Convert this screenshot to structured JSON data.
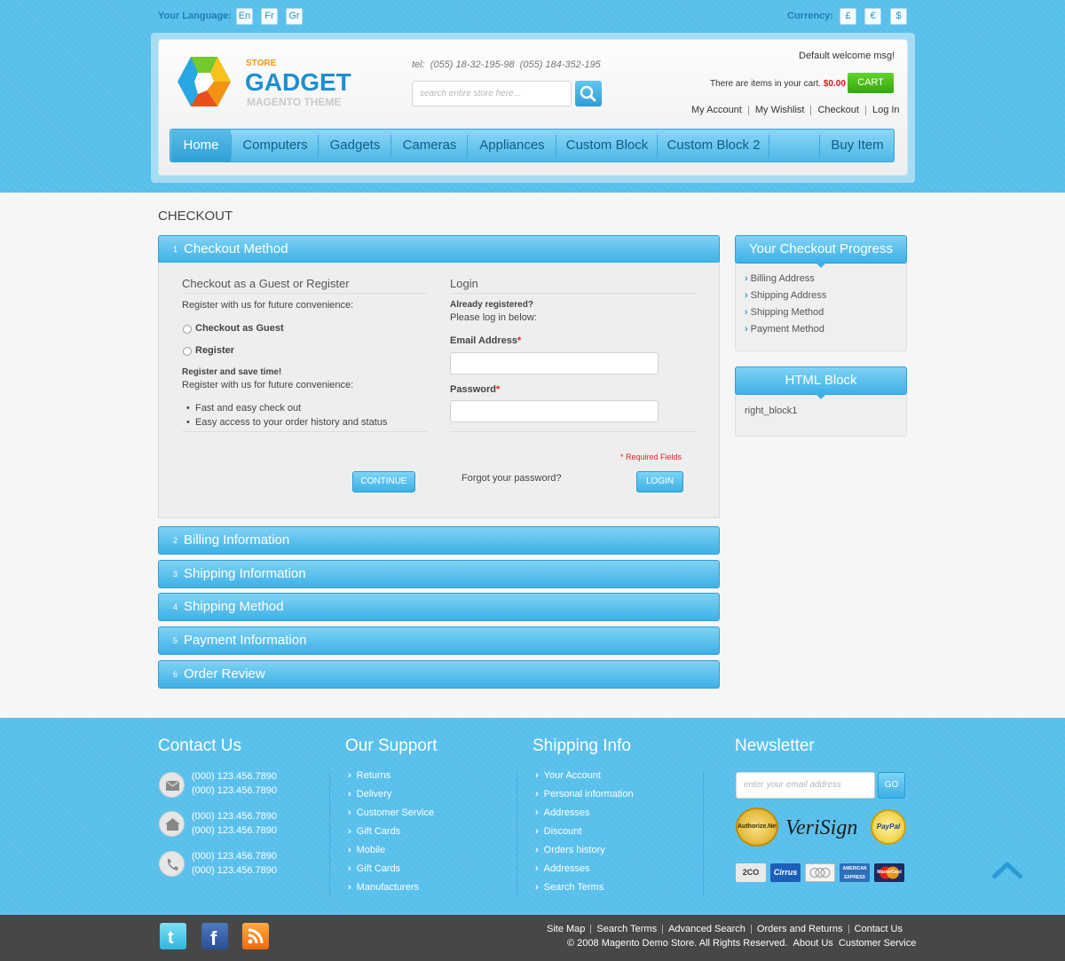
{
  "header": {
    "language_label": "Your Language:",
    "languages": [
      "En",
      "Fr",
      "Gr"
    ],
    "currency_label": "Currency:",
    "currencies": [
      "£",
      "€",
      "$"
    ],
    "logo": {
      "store": "STORE",
      "name": "GADGET",
      "tagline": "MAGENTO THEME"
    },
    "phone": "tel:  (055) 18-32-195-98  (055) 184-352-195",
    "search_placeholder": "search entire store here...",
    "welcome": "Default welcome msg!",
    "cart_text_pre": "There are",
    "cart_text_items": "items",
    "cart_text_post": "in your cart.",
    "cart_total": "$0.00",
    "cart_button": "CART",
    "links": [
      "My Account",
      "My Wishlist",
      "Checkout",
      "Log In"
    ]
  },
  "nav": {
    "items": [
      "Home",
      "Computers",
      "Gadgets",
      "Cameras",
      "Appliances",
      "Custom Block",
      "Custom Block 2"
    ],
    "buy": "Buy Item"
  },
  "page_title": "CHECKOUT",
  "steps": [
    {
      "num": "1",
      "label": "Checkout Method"
    },
    {
      "num": "2",
      "label": "Billing Information"
    },
    {
      "num": "3",
      "label": "Shipping Information"
    },
    {
      "num": "4",
      "label": "Shipping Method"
    },
    {
      "num": "5",
      "label": "Payment Information"
    },
    {
      "num": "6",
      "label": "Order Review"
    }
  ],
  "guest": {
    "heading": "Checkout as a Guest or Register",
    "intro": "Register with us for future convenience:",
    "option_guest": "Checkout as Guest",
    "option_register": "Register",
    "save_time": "Register and save time!",
    "save_intro": "Register with us for future convenience:",
    "bullets": [
      "Fast and easy check out",
      "Easy access to your order history and status"
    ],
    "continue": "CONTINUE"
  },
  "login": {
    "heading": "Login",
    "already": "Already registered?",
    "please": "Please log in below:",
    "email_label": "Email Address",
    "password_label": "Password",
    "required": "* Required Fields",
    "forgot": "Forgot your password?",
    "login_button": "LOGIN"
  },
  "sidebar": {
    "progress_title": "Your Checkout Progress",
    "progress_items": [
      "Billing Address",
      "Shipping Address",
      "Shipping Method",
      "Payment Method"
    ],
    "html_title": "HTML Block",
    "html_content": "right_block1"
  },
  "footer": {
    "contact_title": "Contact Us",
    "contacts": [
      {
        "icon": "mail-icon",
        "lines": [
          "(000) 123.456.7890",
          "(000) 123.456.7890"
        ]
      },
      {
        "icon": "home-icon",
        "lines": [
          "(000) 123.456.7890",
          "(000) 123.456.7890"
        ]
      },
      {
        "icon": "phone-icon",
        "lines": [
          "(000) 123.456.7890",
          "(000) 123.456.7890"
        ]
      }
    ],
    "support_title": "Our Support",
    "support": [
      "Returns",
      "Delivery",
      "Customer Service",
      "Gift Cards",
      "Mobile",
      "Gift Cards",
      "Manufacturers"
    ],
    "shipping_title": "Shipping Info",
    "shipping": [
      "Your Account",
      "Personal information",
      "Addresses",
      "Discount",
      "Orders history",
      "Addresses",
      "Search Terms"
    ],
    "newsletter_title": "Newsletter",
    "newsletter_placeholder": "enter your email address",
    "go": "GO",
    "badges": [
      "Authorize.Net",
      "VeriSign",
      "PayPal"
    ],
    "cards": [
      "2CO",
      "Cirrus",
      "",
      "AMERICAN EXPRESS",
      "MasterCard"
    ],
    "bottom_links": [
      "Site Map",
      "Search Terms",
      "Advanced Search",
      "Orders and Returns",
      "Contact Us"
    ],
    "copyright": "© 2008 Magento Demo Store. All Rights Reserved.",
    "bottom_links2": [
      "About Us",
      "Customer Service"
    ]
  }
}
